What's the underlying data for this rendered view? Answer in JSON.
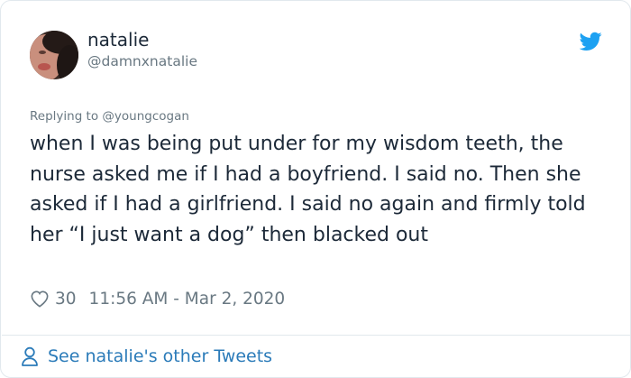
{
  "user": {
    "display_name": "natalie",
    "handle": "@damnxnatalie",
    "avatar_icon": "profile-photo"
  },
  "brand_icon": "twitter-bird-icon",
  "colors": {
    "brand": "#1da1f2",
    "link": "#2b7bb9",
    "secondary_text": "#697882",
    "primary_text": "#1c2938",
    "border": "#e1e8ed"
  },
  "tweet": {
    "replying_to": "Replying to @youngcogan",
    "text": "when I was being put under for my wisdom teeth, the nurse asked me if I had a boyfriend. I said no. Then she asked if I had a girlfriend. I said no again and firmly told her “I just want a dog” then blacked out",
    "like_count": "30",
    "timestamp": "11:56 AM - Mar 2, 2020"
  },
  "footer": {
    "see_more_label": "See natalie's other Tweets",
    "see_more_icon": "person-icon"
  }
}
